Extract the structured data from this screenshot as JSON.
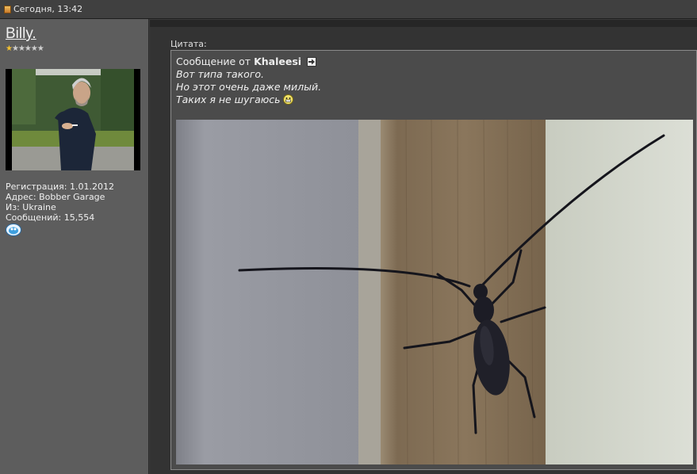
{
  "post": {
    "date": "Сегодня, 13:42"
  },
  "author": {
    "username": "Billy.",
    "stars_total": 6,
    "stars_filled": 1,
    "registration": "Регистрация: 1.01.2012",
    "address": "Адрес: Bobber Garage",
    "from": "Из: Ukraine",
    "messages": "Сообщений: 15,554"
  },
  "quote": {
    "label": "Цитата:",
    "header_prefix": "Сообщение от ",
    "quoted_author": "Khaleesi",
    "lines": [
      "Вот типа такого.",
      "Но этот очень даже милый.",
      "Таких я не шугаюсь"
    ]
  },
  "colors": {
    "star_filled": "#f2c030",
    "star_empty": "#cfcfcf"
  },
  "icons": {
    "post": "post-icon",
    "view_post": "arrow-right-icon",
    "smiley": "grin-smiley-icon",
    "send_message": "message-icon"
  }
}
